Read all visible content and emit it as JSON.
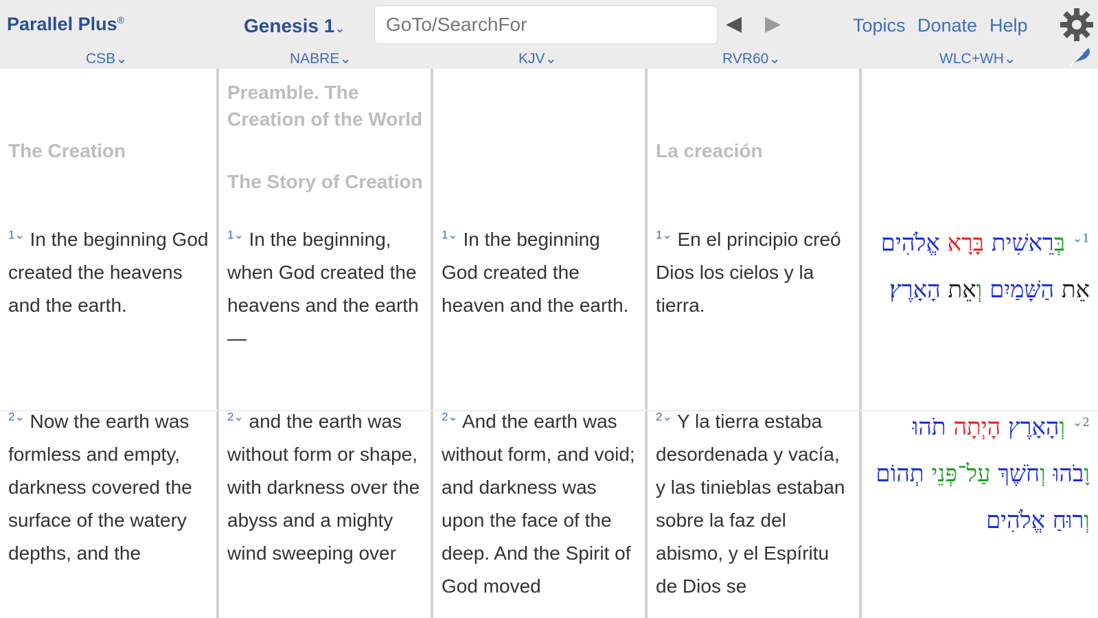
{
  "header": {
    "brand": "Parallel Plus",
    "brand_mark": "®",
    "book": "Genesis 1",
    "search_placeholder": "GoTo/SearchFor",
    "links": {
      "topics": "Topics",
      "donate": "Donate",
      "help": "Help"
    },
    "versions": [
      "CSB",
      "NABRE",
      "KJV",
      "RVR60",
      "WLC+WH"
    ]
  },
  "columns": {
    "csb": {
      "heading": "The Creation",
      "v1": "In the beginning God created the heavens and the earth.",
      "v2": "Now the earth was formless and empty, darkness covered the surface of the watery depths, and the"
    },
    "nabre": {
      "heading1": "Preamble. The Creation of the World",
      "heading2": "The Story of Creation",
      "v1": "In the beginning, when God created the heavens and the earth—",
      "v2": "and the earth was without form or shape, with darkness over the abyss and a mighty wind sweeping over"
    },
    "kjv": {
      "v1": "In the beginning God created the heaven and the earth.",
      "v2": "And the earth was without form, and void; and darkness was upon the face of the deep. And the Spirit of God moved"
    },
    "rvr60": {
      "heading": "La creación",
      "v1": "En el principio creó Dios los cielos y la tierra.",
      "v2": "Y la tierra estaba desordenada y vacía, y las tinieblas estaban sobre la faz del abismo, y el Espíritu de Dios se"
    },
    "wlc": {
      "v1": [
        "בְּ",
        "רֵאשִׁית",
        "בָּרָא",
        "אֱלֹהִים",
        "אֵת",
        "הַשָּׁמַיִם",
        "וְ",
        "אֵת",
        "הָאָרֶץ׃"
      ],
      "v2": [
        "וְ",
        "הָאָרֶץ",
        "הָיְתָה",
        "תֹהוּ",
        "וָ",
        "בֹהוּ",
        "וְ",
        "חֹשֶׁךְ",
        "עַל־פְּנֵי",
        "תְהוֹם",
        "וְ",
        "רוּחַ",
        "אֱלֹהִים"
      ]
    }
  },
  "verse_numbers": [
    "1",
    "2"
  ],
  "colors": {
    "brand": "#2b4f94",
    "link": "#3f6db8",
    "heading": "#bdbdbd",
    "divider": "#d2d2d2"
  }
}
